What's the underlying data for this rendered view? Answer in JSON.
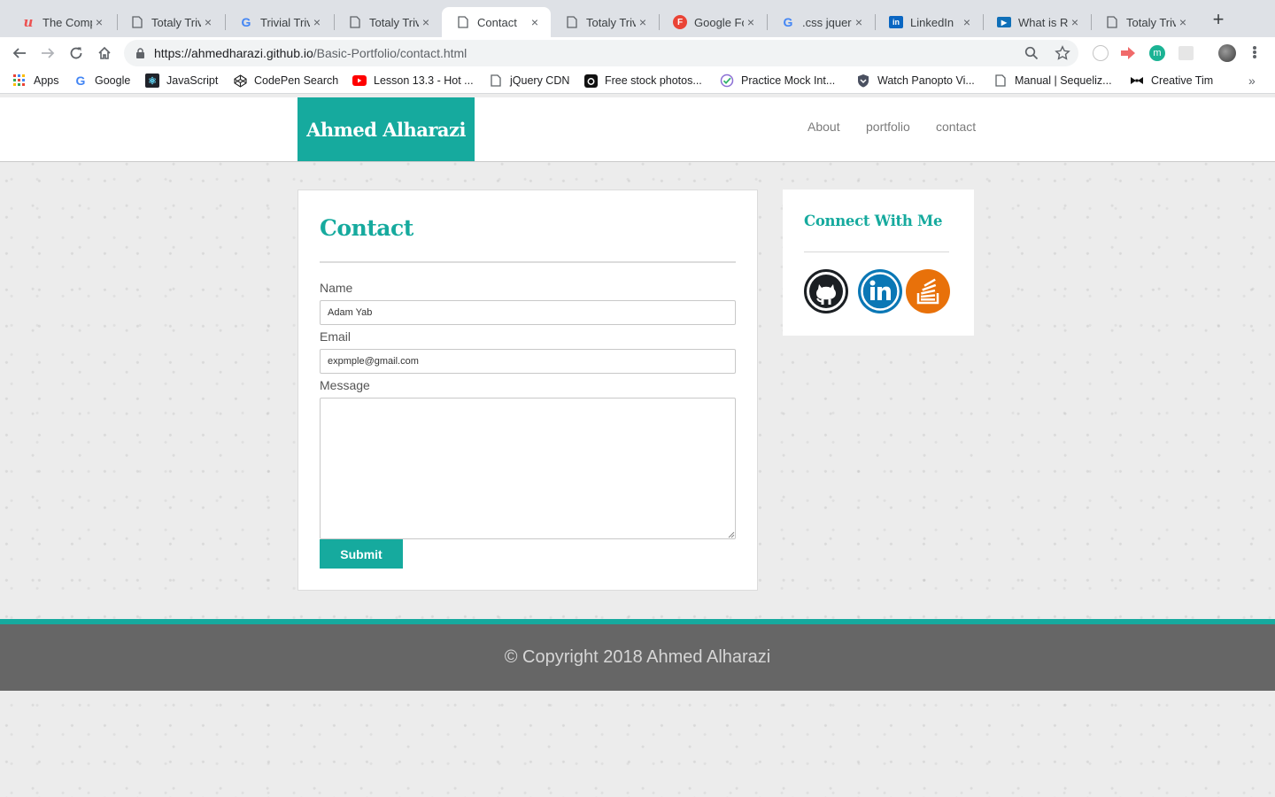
{
  "browser": {
    "tabs": [
      {
        "title": "The Comp",
        "icon": "udemy-icon",
        "color": "#ec5252",
        "active": false
      },
      {
        "title": "Totaly Triv",
        "icon": "page-icon",
        "active": false
      },
      {
        "title": "Trivial Triv",
        "icon": "google-icon",
        "active": false
      },
      {
        "title": "Totaly Triv",
        "icon": "page-icon",
        "active": false
      },
      {
        "title": "Contact",
        "icon": "page-icon",
        "active": true
      },
      {
        "title": "Totaly Triv",
        "icon": "page-icon",
        "active": false
      },
      {
        "title": "Google Fo",
        "icon": "google-fonts-icon",
        "color": "#ea4335",
        "active": false
      },
      {
        "title": ".css jquer",
        "icon": "google-icon",
        "active": false
      },
      {
        "title": "LinkedIn",
        "icon": "linkedin-icon",
        "color": "#0a66c2",
        "active": false
      },
      {
        "title": "What is Re",
        "icon": "panopto-icon",
        "color": "#0f6fb8",
        "active": false
      },
      {
        "title": "Totaly Triv",
        "icon": "page-icon",
        "active": false
      }
    ],
    "url_host": "https://ahmedharazi.github.io",
    "url_path": "/Basic-Portfolio/contact.html",
    "bookmarks": [
      {
        "label": "Apps",
        "icon": "apps-grid-icon"
      },
      {
        "label": "Google",
        "icon": "google-icon"
      },
      {
        "label": "JavaScript",
        "icon": "react-icon"
      },
      {
        "label": "CodePen Search",
        "icon": "codepen-icon"
      },
      {
        "label": "Lesson 13.3 - Hot ...",
        "icon": "youtube-icon"
      },
      {
        "label": "jQuery CDN",
        "icon": "page-icon"
      },
      {
        "label": "Free stock photos...",
        "icon": "camera-icon"
      },
      {
        "label": "Practice Mock Int...",
        "icon": "check-circle-icon"
      },
      {
        "label": "Watch Panopto Vi...",
        "icon": "shield-icon"
      },
      {
        "label": "Manual | Sequeliz...",
        "icon": "page-icon"
      },
      {
        "label": "Creative Tim",
        "icon": "bowtie-icon"
      }
    ],
    "more_bookmarks": "»"
  },
  "site": {
    "brand": "Ahmed Alharazi",
    "nav": [
      "About",
      "portfolio",
      "contact"
    ],
    "accent": "#16aa9e"
  },
  "contact": {
    "title": "Contact",
    "name_label": "Name",
    "name_value": "Adam Yab",
    "email_label": "Email",
    "email_value": "expmple@gmail.com",
    "message_label": "Message",
    "message_value": "",
    "submit": "Submit"
  },
  "social": {
    "title": "Connect With Me",
    "icons": [
      {
        "name": "github-icon",
        "color": "#1b1f23"
      },
      {
        "name": "linkedin-icon",
        "color": "#0a77b5"
      },
      {
        "name": "stackoverflow-icon",
        "color": "#e8710a"
      }
    ]
  },
  "footer": {
    "text": "© Copyright 2018 Ahmed Alharazi"
  }
}
